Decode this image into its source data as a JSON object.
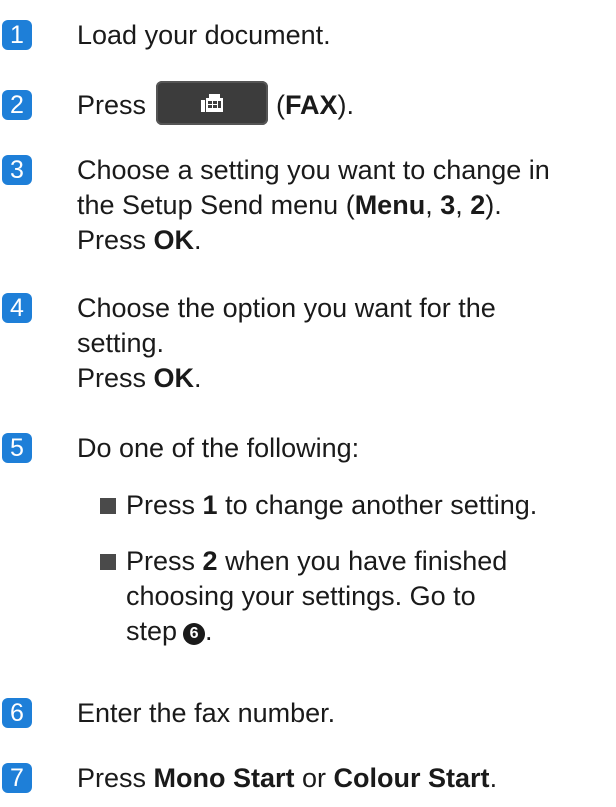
{
  "steps": [
    {
      "num": "1",
      "line1": "Load your document."
    },
    {
      "num": "2",
      "press": "Press",
      "open_paren": "(",
      "fax": "FAX",
      "close": ")."
    },
    {
      "num": "3",
      "l1": "Choose a setting you want to change in",
      "l2a": "the Setup Send menu (",
      "menu": "Menu",
      "c1": ", ",
      "n3": "3",
      "c2": ", ",
      "n2": "2",
      "l2e": ").",
      "l3a": "Press ",
      "ok": "OK",
      "dot": "."
    },
    {
      "num": "4",
      "l1": "Choose the option you want for the",
      "l2": "setting.",
      "l3a": "Press ",
      "ok": "OK",
      "dot": "."
    },
    {
      "num": "5",
      "l1": "Do one of the following:"
    },
    {
      "num": "6",
      "l1": "Enter the fax number."
    },
    {
      "num": "7",
      "l1a": "Press ",
      "mono": "Mono Start",
      "or": " or ",
      "colour": "Colour Start",
      "dot": "."
    }
  ],
  "bullets": [
    {
      "a": "Press ",
      "key": "1",
      "b": " to change another setting."
    },
    {
      "a": "Press ",
      "key": "2",
      "b": " when you have finished",
      "l2": "choosing your settings. Go to",
      "l3": "step",
      "ref": "6",
      "dot": "."
    }
  ],
  "icons": {
    "fax_button": "fax-icon"
  },
  "colors": {
    "badge": "#1e7fd8",
    "button": "#3c3c3c"
  }
}
